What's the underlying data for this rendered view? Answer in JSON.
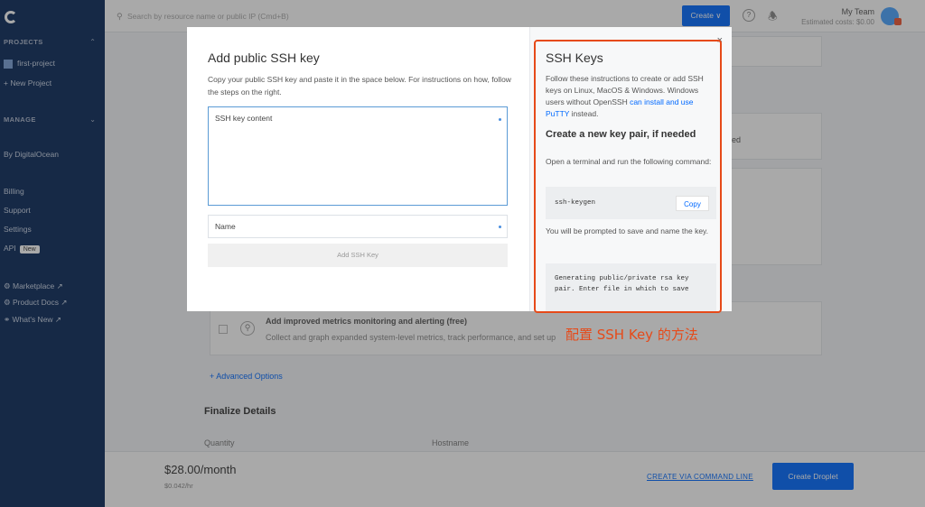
{
  "topbar": {
    "search_placeholder": "Search by resource name or public IP (Cmd+B)",
    "create_label": "Create ∨",
    "team_name": "My Team",
    "estimated_cost": "Estimated costs: $0.00"
  },
  "sidebar": {
    "projects_label": "PROJECTS",
    "project_item": "first-project",
    "new_project": "+ New Project",
    "manage_label": "MANAGE",
    "by_do": "By DigitalOcean",
    "billing": "Billing",
    "support": "Support",
    "settings": "Settings",
    "api": "API",
    "api_badge": "New",
    "marketplace": "Marketplace ↗",
    "product_docs": "Product Docs ↗",
    "whats_new": "What's New ↗"
  },
  "page": {
    "metrics_title": "Add improved metrics monitoring and alerting (free)",
    "metrics_desc": "Collect and graph expanded system-level metrics, track performance, and set up",
    "advanced_options": "+ Advanced Options",
    "finalize_title": "Finalize Details",
    "quantity_label": "Quantity",
    "hostname_label": "Hostname",
    "partial_text": "ed"
  },
  "bottombar": {
    "price": "$28.00/month",
    "price_hr": "$0.042/hr",
    "cli_link": "CREATE VIA COMMAND LINE",
    "create_droplet": "Create Droplet"
  },
  "modal": {
    "title": "Add public SSH key",
    "description": "Copy your public SSH key and paste it in the space below. For instructions on how, follow the steps on the right.",
    "ssh_placeholder": "SSH key content",
    "name_placeholder": "Name",
    "add_button": "Add SSH Key",
    "close": "×"
  },
  "help": {
    "title": "SSH Keys",
    "intro": "Follow these instructions to create or add SSH keys on Linux, MacOS & Windows. Windows users without OpenSSH ",
    "intro_link": "can install and use PuTTY",
    "intro_end": " instead.",
    "heading": "Create a new key pair, if needed",
    "step1": "Open a terminal and run the following command:",
    "command": "ssh-keygen",
    "copy_label": "Copy",
    "step2": "You will be prompted to save and name the key.",
    "output": "Generating public/private rsa key pair. Enter file in which to save"
  },
  "annotation": {
    "label": "配置 SSH Key 的方法",
    "color": "#e64a19"
  },
  "icons": [
    "logo-icon",
    "search-icon",
    "help-icon",
    "bell-icon",
    "close-icon",
    "metrics-icon"
  ]
}
